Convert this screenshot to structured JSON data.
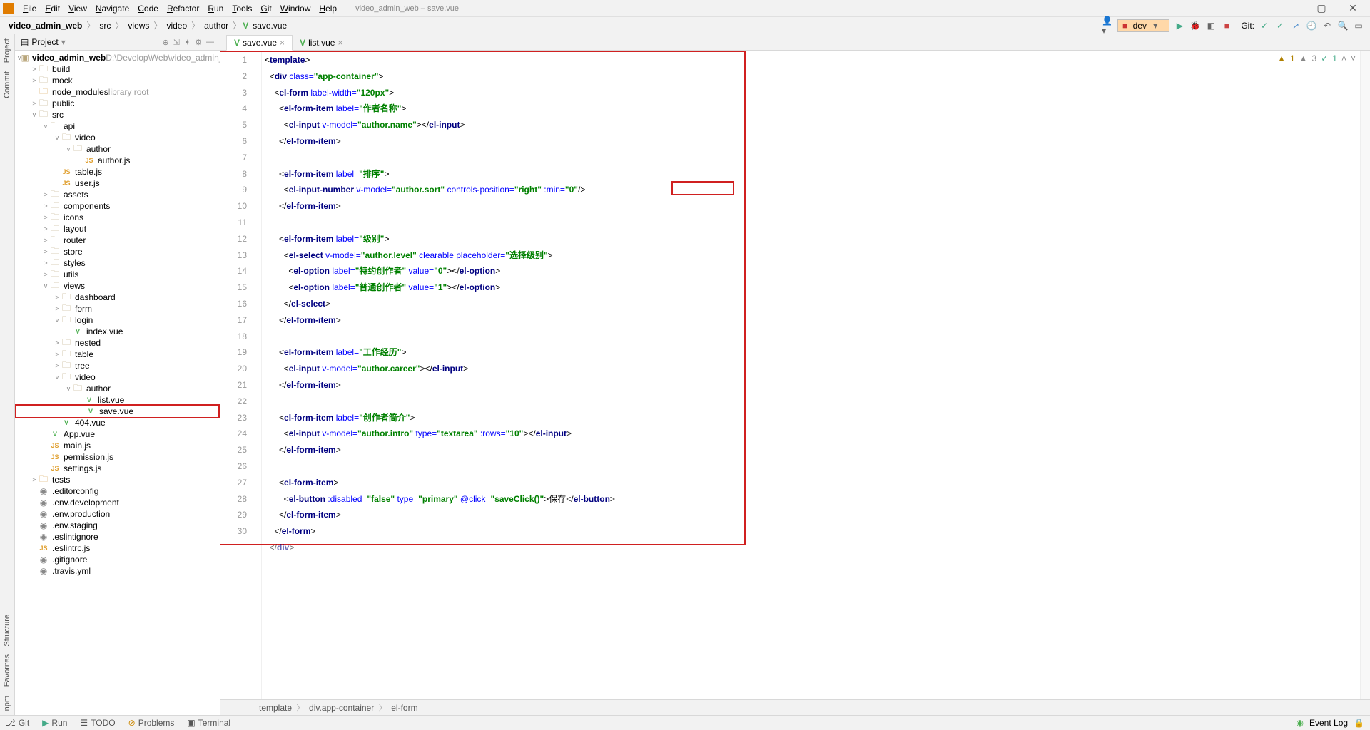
{
  "app_title": "video_admin_web – save.vue",
  "menu": [
    "File",
    "Edit",
    "View",
    "Navigate",
    "Code",
    "Refactor",
    "Run",
    "Tools",
    "Git",
    "Window",
    "Help"
  ],
  "breadcrumbs": {
    "project": "video_admin_web",
    "parts": [
      "src",
      "views",
      "video",
      "author",
      "save.vue"
    ]
  },
  "run_config": "dev",
  "git_label": "Git:",
  "project_panel_title": "Project",
  "tree": {
    "root": "video_admin_web",
    "root_path": "D:\\Develop\\Web\\video_admin_web",
    "nodes": [
      {
        "d": 1,
        "a": ">",
        "t": "folder",
        "l": "build"
      },
      {
        "d": 1,
        "a": ">",
        "t": "folder",
        "l": "mock"
      },
      {
        "d": 1,
        "a": " ",
        "t": "libfolder",
        "l": "node_modules",
        "note": "library root"
      },
      {
        "d": 1,
        "a": ">",
        "t": "folder",
        "l": "public"
      },
      {
        "d": 1,
        "a": "v",
        "t": "folder",
        "l": "src"
      },
      {
        "d": 2,
        "a": "v",
        "t": "folder",
        "l": "api"
      },
      {
        "d": 3,
        "a": "v",
        "t": "folder",
        "l": "video"
      },
      {
        "d": 4,
        "a": "v",
        "t": "folder",
        "l": "author"
      },
      {
        "d": 5,
        "a": " ",
        "t": "js",
        "l": "author.js"
      },
      {
        "d": 3,
        "a": " ",
        "t": "js",
        "l": "table.js"
      },
      {
        "d": 3,
        "a": " ",
        "t": "js",
        "l": "user.js"
      },
      {
        "d": 2,
        "a": ">",
        "t": "folder",
        "l": "assets"
      },
      {
        "d": 2,
        "a": ">",
        "t": "folder",
        "l": "components"
      },
      {
        "d": 2,
        "a": ">",
        "t": "folder",
        "l": "icons"
      },
      {
        "d": 2,
        "a": ">",
        "t": "folder",
        "l": "layout"
      },
      {
        "d": 2,
        "a": ">",
        "t": "folder",
        "l": "router"
      },
      {
        "d": 2,
        "a": ">",
        "t": "folder",
        "l": "store"
      },
      {
        "d": 2,
        "a": ">",
        "t": "folder",
        "l": "styles"
      },
      {
        "d": 2,
        "a": ">",
        "t": "folder",
        "l": "utils"
      },
      {
        "d": 2,
        "a": "v",
        "t": "folder",
        "l": "views"
      },
      {
        "d": 3,
        "a": ">",
        "t": "folder",
        "l": "dashboard"
      },
      {
        "d": 3,
        "a": ">",
        "t": "folder",
        "l": "form"
      },
      {
        "d": 3,
        "a": "v",
        "t": "folder",
        "l": "login"
      },
      {
        "d": 4,
        "a": " ",
        "t": "vue",
        "l": "index.vue"
      },
      {
        "d": 3,
        "a": ">",
        "t": "folder",
        "l": "nested"
      },
      {
        "d": 3,
        "a": ">",
        "t": "folder",
        "l": "table"
      },
      {
        "d": 3,
        "a": ">",
        "t": "folder",
        "l": "tree"
      },
      {
        "d": 3,
        "a": "v",
        "t": "folder",
        "l": "video"
      },
      {
        "d": 4,
        "a": "v",
        "t": "folder",
        "l": "author"
      },
      {
        "d": 5,
        "a": " ",
        "t": "vue",
        "l": "list.vue"
      },
      {
        "d": 5,
        "a": " ",
        "t": "vue",
        "l": "save.vue",
        "boxed": true
      },
      {
        "d": 3,
        "a": " ",
        "t": "vue",
        "l": "404.vue"
      },
      {
        "d": 2,
        "a": " ",
        "t": "vue",
        "l": "App.vue"
      },
      {
        "d": 2,
        "a": " ",
        "t": "js",
        "l": "main.js"
      },
      {
        "d": 2,
        "a": " ",
        "t": "js",
        "l": "permission.js"
      },
      {
        "d": 2,
        "a": " ",
        "t": "js",
        "l": "settings.js"
      },
      {
        "d": 1,
        "a": ">",
        "t": "libfolder",
        "l": "tests"
      },
      {
        "d": 1,
        "a": " ",
        "t": "file",
        "l": ".editorconfig"
      },
      {
        "d": 1,
        "a": " ",
        "t": "file",
        "l": ".env.development"
      },
      {
        "d": 1,
        "a": " ",
        "t": "file",
        "l": ".env.production"
      },
      {
        "d": 1,
        "a": " ",
        "t": "file",
        "l": ".env.staging"
      },
      {
        "d": 1,
        "a": " ",
        "t": "file",
        "l": ".eslintignore"
      },
      {
        "d": 1,
        "a": " ",
        "t": "js",
        "l": ".eslintrc.js"
      },
      {
        "d": 1,
        "a": " ",
        "t": "file",
        "l": ".gitignore"
      },
      {
        "d": 1,
        "a": " ",
        "t": "file",
        "l": ".travis.yml"
      }
    ]
  },
  "editor_tabs": [
    {
      "label": "save.vue",
      "active": true
    },
    {
      "label": "list.vue",
      "active": false
    }
  ],
  "inspection": {
    "warn": "1",
    "weak": "3",
    "ok": "1"
  },
  "editor_breadcrumbs": [
    "template",
    "div.app-container",
    "el-form"
  ],
  "code_lines": 30,
  "left_vtabs": [
    "Project",
    "Commit",
    "Structure",
    "Favorites",
    "npm"
  ],
  "bottom_tools": [
    "Git",
    "Run",
    "TODO",
    "Problems",
    "Terminal"
  ],
  "event_log": "Event Log"
}
